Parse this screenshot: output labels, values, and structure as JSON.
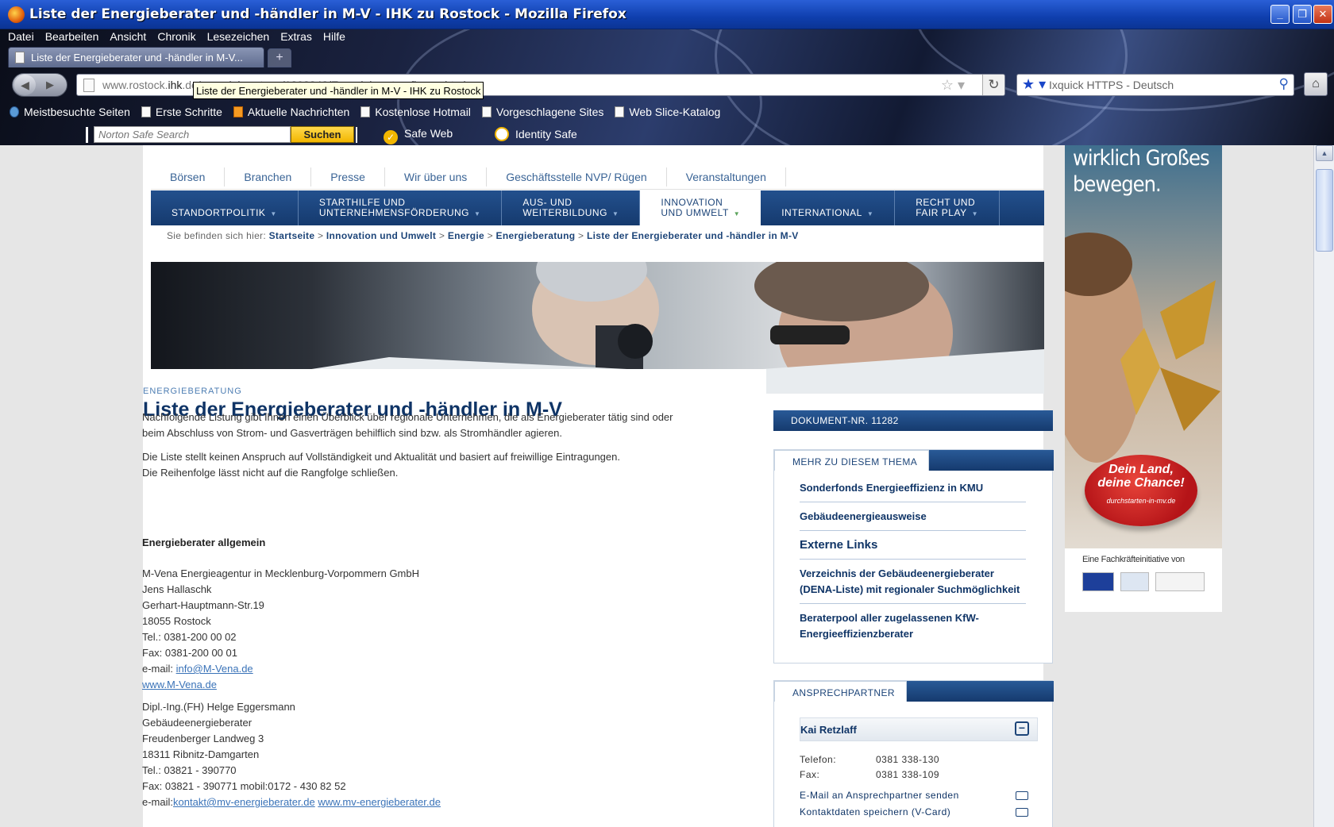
{
  "window": {
    "title": "Liste der Energieberater und -händler in M-V - IHK zu Rostock - Mozilla Firefox",
    "min": "_",
    "max": "❐",
    "close": "✕"
  },
  "menu": [
    "Datei",
    "Bearbeiten",
    "Ansicht",
    "Chronik",
    "Lesezeichen",
    "Extras",
    "Hilfe"
  ],
  "tab": {
    "label": "Liste der Energieberater und -händler in M-V..."
  },
  "url": {
    "prefix": "www.rostock.",
    "host": "ihk",
    "rest": ".de/energieberatung/1293342/Energieberater_firmen.html"
  },
  "tooltip": "Liste der Energieberater und -händler in M-V - IHK zu Rostock",
  "search": {
    "placeholder": "Ixquick HTTPS - Deutsch"
  },
  "bookmarks": [
    "Meistbesuchte Seiten",
    "Erste Schritte",
    "Aktuelle Nachrichten",
    "Kostenlose Hotmail",
    "Vorgeschlagene Sites",
    "Web Slice-Katalog"
  ],
  "norton": {
    "placeholder": "Norton Safe Search",
    "button": "Suchen",
    "safe_web": "Safe Web",
    "identity_safe": "Identity Safe"
  },
  "topnav": [
    "Börsen",
    "Branchen",
    "Presse",
    "Wir über uns",
    "Geschäftsstelle NVP/ Rügen",
    "Veranstaltungen"
  ],
  "mainnav": [
    {
      "l1": "STANDORTPOLITIK",
      "l2": ""
    },
    {
      "l1": "STARTHILFE UND",
      "l2": "UNTERNEHMENSFÖRDERUNG"
    },
    {
      "l1": "AUS- UND",
      "l2": "WEITERBILDUNG"
    },
    {
      "l1": "INNOVATION",
      "l2": "UND UMWELT"
    },
    {
      "l1": "INTERNATIONAL",
      "l2": ""
    },
    {
      "l1": "RECHT UND",
      "l2": "FAIR PLAY"
    }
  ],
  "breadcrumb": {
    "prefix": "Sie befinden sich hier:",
    "items": [
      "Startseite",
      "Innovation und Umwelt",
      "Energie",
      "Energieberatung",
      "Liste der Energieberater und -händler in M-V"
    ],
    "sep": ">"
  },
  "article": {
    "kicker": "ENERGIEBERATUNG",
    "title": "Liste der Energieberater und -händler in M-V",
    "intro1a": "Nachfolgende Listung gibt Ihnen einen Überblick über regionale Unternehmen, die als Energieberater tätig sind oder",
    "intro1b": "beim Abschluss von Strom- und Gasverträgen behilflich sind bzw. als Stromhändler agieren.",
    "intro2a": "Die Liste stellt keinen Anspruch auf Vollständigkeit und Aktualität und basiert auf freiwillige Eintragungen.",
    "intro2b": "Die Reihenfolge lässt nicht auf die Rangfolge schließen.",
    "section": "Energieberater allgemein",
    "entry1": [
      "M-Vena Energieagentur in Mecklenburg-Vorpommern GmbH",
      "Jens Hallaschk",
      "Gerhart-Hauptmann-Str.19",
      "18055 Rostock",
      "Tel.: 0381-200 00 02",
      "Fax: 0381-200 00 01"
    ],
    "entry1_mail_label": "e-mail: ",
    "entry1_mail": "info@M-Vena.de",
    "entry1_web": "www.M-Vena.de",
    "entry2": [
      "Dipl.-Ing.(FH) Helge Eggersmann",
      "Gebäudeenergieberater",
      "Freudenberger Landweg 3",
      "18311 Ribnitz-Damgarten",
      "Tel.: 03821 - 390770",
      "Fax: 03821 - 390771 mobil:0172 - 430 82 52"
    ],
    "entry2_mail_label": "e-mail:",
    "entry2_mail": "kontakt@mv-energieberater.de",
    "entry2_web": "www.mv-energieberater.de"
  },
  "sidebar": {
    "doc": "DOKUMENT-NR. 11282",
    "more_title": "MEHR ZU DIESEM THEMA",
    "more_links": [
      "Sonderfonds Energieeffizienz in KMU",
      "Gebäudeenergieausweise",
      "Externe Links",
      "Verzeichnis der Gebäudeenergieberater (DENA-Liste) mit regionaler Suchmöglichkeit",
      "Beraterpool aller zugelassenen KfW-Energieeffizienzberater"
    ],
    "contact_title": "ANSPRECHPARTNER",
    "contact_name": "Kai Retzlaff",
    "phone_label": "Telefon:",
    "phone": "0381 338-130",
    "fax_label": "Fax:",
    "fax": "0381 338-109",
    "mail_link": "E-Mail an Ansprechpartner senden",
    "vcard_link": "Kontaktdaten speichern (V-Card)"
  },
  "ad": {
    "line1": "wirklich Großes",
    "line2": "bewegen.",
    "badge1": "Dein Land,",
    "badge2": "deine Chance!",
    "badge3": "durchstarten-in-mv.de",
    "initiative": "Eine Fachkräfteinitiative von"
  },
  "colors": {
    "nav_blue": "#153a6e",
    "link_blue": "#3a73b8",
    "title_blue": "#0f3466"
  }
}
